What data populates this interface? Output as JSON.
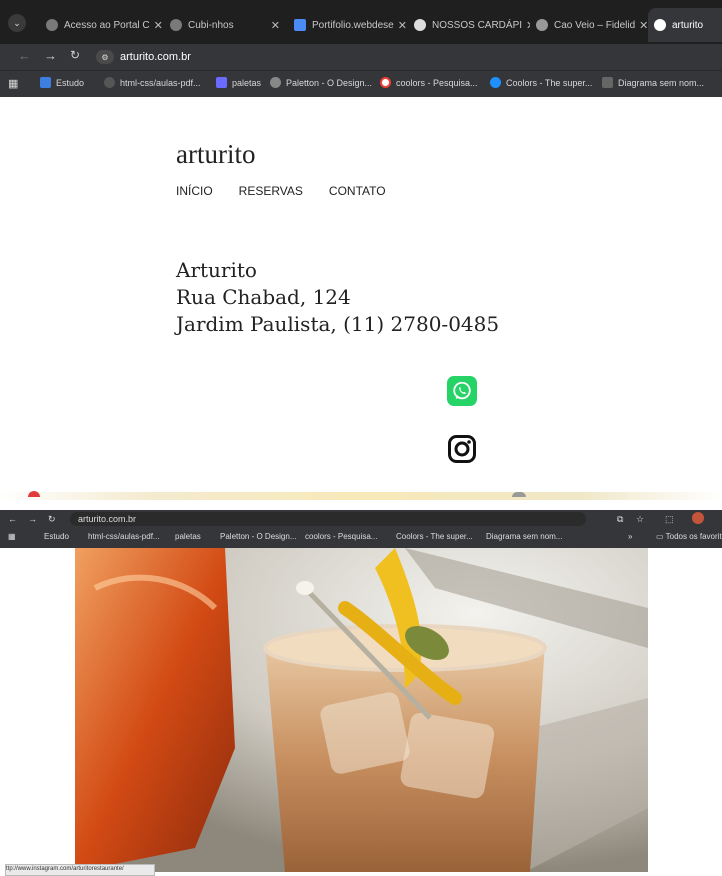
{
  "browser": {
    "tabs": [
      {
        "title": "Acesso ao Portal C",
        "active": false
      },
      {
        "title": "Cubi-nhos",
        "active": false
      },
      {
        "title": "Portifolio.webdese",
        "active": false
      },
      {
        "title": "NOSSOS CARDÁPI",
        "active": false
      },
      {
        "title": "Cao Veio – Fidelid",
        "active": false
      },
      {
        "title": "arturito",
        "active": true
      }
    ],
    "url": "arturito.com.br",
    "bookmarks": [
      "Estudo",
      "html-css/aulas-pdf...",
      "paletas",
      "Paletton - O Design...",
      "coolors - Pesquisa...",
      "Coolors - The super...",
      "Diagrama sem nom..."
    ],
    "bookmarks_more": "»",
    "all_favorites": "Todos os favoritos"
  },
  "site": {
    "logo": "arturito",
    "menu": [
      "INÍCIO",
      "RESERVAS",
      "CONTATO"
    ],
    "address": [
      "Arturito",
      "Rua Chabad, 124",
      "Jardim Paulista, (11) 2780-0485"
    ]
  },
  "status_url": "ttp://www.instagram.com/arturitorestaurante/",
  "colors": {
    "whatsapp": "#25d366",
    "chrome_dark": "#1f1f1f",
    "chrome": "#35363a"
  },
  "icons": [
    "whatsapp-icon",
    "instagram-icon"
  ]
}
